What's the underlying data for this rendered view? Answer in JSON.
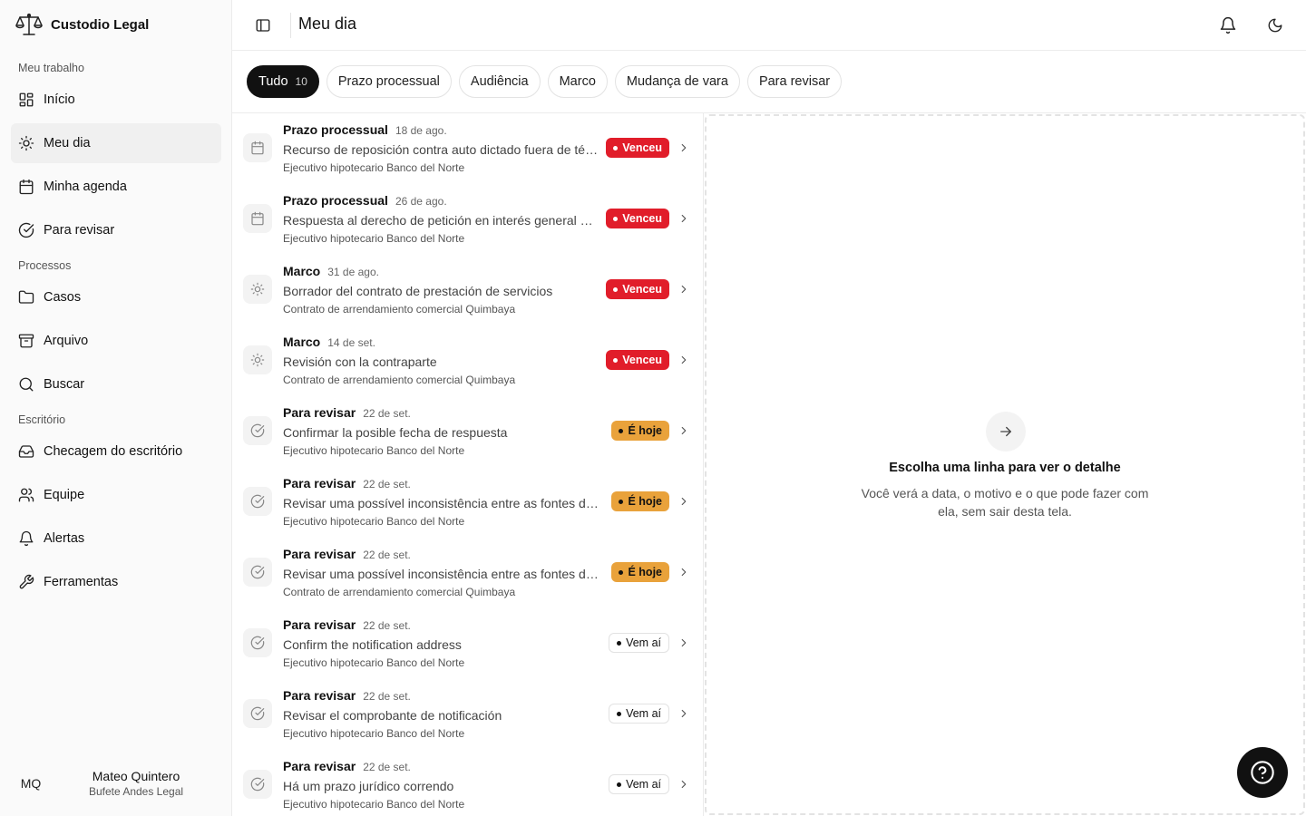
{
  "app": {
    "name": "Custodio Legal"
  },
  "sidebar": {
    "sections": [
      {
        "label": "Meu trabalho",
        "items": [
          {
            "label": "Início",
            "icon": "dashboard-icon"
          },
          {
            "label": "Meu dia",
            "icon": "sun-icon",
            "active": true
          },
          {
            "label": "Minha agenda",
            "icon": "calendar-icon"
          },
          {
            "label": "Para revisar",
            "icon": "check-circle-icon"
          }
        ]
      },
      {
        "label": "Processos",
        "items": [
          {
            "label": "Casos",
            "icon": "folder-icon"
          },
          {
            "label": "Arquivo",
            "icon": "archive-icon"
          },
          {
            "label": "Buscar",
            "icon": "search-icon"
          }
        ]
      },
      {
        "label": "Escritório",
        "items": [
          {
            "label": "Checagem do escritório",
            "icon": "inbox-icon"
          },
          {
            "label": "Equipe",
            "icon": "users-icon"
          },
          {
            "label": "Alertas",
            "icon": "bell-icon"
          },
          {
            "label": "Ferramentas",
            "icon": "wrench-icon"
          }
        ]
      }
    ],
    "user": {
      "initials": "MQ",
      "name": "Mateo Quintero",
      "org": "Bufete Andes Legal"
    }
  },
  "header": {
    "title": "Meu dia"
  },
  "filters": [
    {
      "label": "Tudo",
      "count": "10",
      "active": true
    },
    {
      "label": "Prazo processual"
    },
    {
      "label": "Audiência"
    },
    {
      "label": "Marco"
    },
    {
      "label": "Mudança de vara"
    },
    {
      "label": "Para revisar"
    }
  ],
  "items": [
    {
      "type": "Prazo processual",
      "date": "18 de ago.",
      "title": "Recurso de reposición contra auto dictado fuera de término",
      "case": "Ejecutivo hipotecario Banco del Norte",
      "status": "Venceu",
      "status_kind": "overdue",
      "icon": "calendar-icon"
    },
    {
      "type": "Prazo processual",
      "date": "26 de ago.",
      "title": "Respuesta al derecho de petición en interés general del cliente",
      "case": "Ejecutivo hipotecario Banco del Norte",
      "status": "Venceu",
      "status_kind": "overdue",
      "icon": "calendar-icon"
    },
    {
      "type": "Marco",
      "date": "31 de ago.",
      "title": "Borrador del contrato de prestación de servicios",
      "case": "Contrato de arrendamiento comercial Quimbaya",
      "status": "Venceu",
      "status_kind": "overdue",
      "icon": "sun-icon"
    },
    {
      "type": "Marco",
      "date": "14 de set.",
      "title": "Revisión con la contraparte",
      "case": "Contrato de arrendamiento comercial Quimbaya",
      "status": "Venceu",
      "status_kind": "overdue",
      "icon": "sun-icon"
    },
    {
      "type": "Para revisar",
      "date": "22 de set.",
      "title": "Confirmar la posible fecha de respuesta",
      "case": "Ejecutivo hipotecario Banco del Norte",
      "status": "É hoje",
      "status_kind": "today",
      "icon": "check-circle-icon"
    },
    {
      "type": "Para revisar",
      "date": "22 de set.",
      "title": "Revisar uma possível inconsistência entre as fontes do caso",
      "case": "Ejecutivo hipotecario Banco del Norte",
      "status": "É hoje",
      "status_kind": "today",
      "icon": "check-circle-icon"
    },
    {
      "type": "Para revisar",
      "date": "22 de set.",
      "title": "Revisar uma possível inconsistência entre as fontes do caso",
      "case": "Contrato de arrendamiento comercial Quimbaya",
      "status": "É hoje",
      "status_kind": "today",
      "icon": "check-circle-icon"
    },
    {
      "type": "Para revisar",
      "date": "22 de set.",
      "title": "Confirm the notification address",
      "case": "Ejecutivo hipotecario Banco del Norte",
      "status": "Vem aí",
      "status_kind": "upcoming",
      "icon": "check-circle-icon"
    },
    {
      "type": "Para revisar",
      "date": "22 de set.",
      "title": "Revisar el comprobante de notificación",
      "case": "Ejecutivo hipotecario Banco del Norte",
      "status": "Vem aí",
      "status_kind": "upcoming",
      "icon": "check-circle-icon"
    },
    {
      "type": "Para revisar",
      "date": "22 de set.",
      "title": "Há um prazo jurídico correndo",
      "case": "Ejecutivo hipotecario Banco del Norte",
      "status": "Vem aí",
      "status_kind": "upcoming",
      "icon": "check-circle-icon"
    }
  ],
  "detail": {
    "title": "Escolha uma linha para ver o detalhe",
    "description": "Você verá a data, o motivo e o que pode fazer com ela, sem sair desta tela."
  },
  "colors": {
    "overdue": "#e11d2a",
    "today": "#e9a23b",
    "primary": "#111111"
  }
}
